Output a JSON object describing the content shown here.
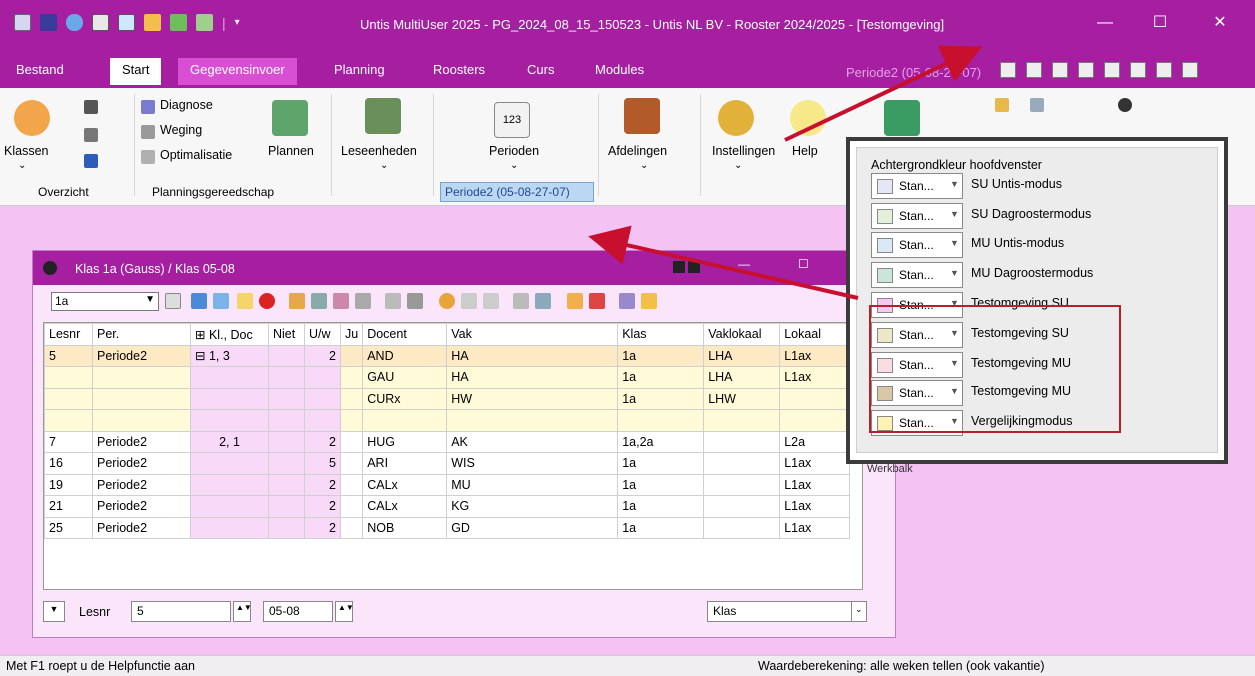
{
  "window": {
    "title": "Untis MultiUser 2025 - PG_2024_08_15_150523  -  Untis NL BV  -  Rooster 2024/2025 - [Testomgeving]",
    "minimize": "—",
    "maximize": "☐",
    "close": "✕",
    "titlebar_color": "#a51fa0"
  },
  "tabs": [
    {
      "label": "Bestand"
    },
    {
      "label": "Start"
    },
    {
      "label": "Gegevensinvoer"
    },
    {
      "label": "Planning"
    },
    {
      "label": "Roosters"
    },
    {
      "label": "Curs"
    },
    {
      "label": "Modules"
    }
  ],
  "tab_period_label": "Periode2 (05-08-27-07)",
  "ribbon": {
    "klassen": "Klassen",
    "overzicht": "Overzicht",
    "diagnose": "Diagnose",
    "weging": "Weging",
    "optimalisatie": "Optimalisatie",
    "plannen": "Plannen",
    "planningsgereedschap": "Planningsgereedschap",
    "leseenheden": "Leseenheden",
    "perioden": "Perioden",
    "period_box": "Periode2 (05-08-27-07)",
    "afdelingen": "Afdelingen",
    "instellingen": "Instellingen",
    "help": "Help",
    "chevron": "⌄"
  },
  "child_window": {
    "title": "Klas 1a (Gauss) / Klas  05-08",
    "klas_combo": "1a",
    "columns": [
      "Lesnr",
      "Per.",
      "Kl., Doc",
      "Niet",
      "U/w",
      "Ju",
      "Docent",
      "Vak",
      "Klas",
      "Vaklokaal",
      "Lokaal"
    ],
    "rows": [
      {
        "lesnr": "5",
        "per": "Periode2",
        "kl": "⊟ 1, 3",
        "uw": "2",
        "docent": "AND",
        "vak": "HA",
        "klas": "1a",
        "vaklokaal": "LHA",
        "lokaal": "L1ax",
        "kind": "sel"
      },
      {
        "lesnr": "",
        "per": "",
        "kl": "",
        "uw": "",
        "docent": "GAU",
        "vak": "HA",
        "klas": "1a",
        "vaklokaal": "LHA",
        "lokaal": "L1ax",
        "kind": "sub"
      },
      {
        "lesnr": "",
        "per": "",
        "kl": "",
        "uw": "",
        "docent": "CURx",
        "vak": "HW",
        "klas": "1a",
        "vaklokaal": "LHW",
        "lokaal": "",
        "kind": "sub"
      },
      {
        "lesnr": "",
        "per": "",
        "kl": "",
        "uw": "",
        "docent": "",
        "vak": "",
        "klas": "",
        "vaklokaal": "",
        "lokaal": "",
        "kind": "sub"
      },
      {
        "lesnr": "7",
        "per": "Periode2",
        "kl": "2, 1",
        "uw": "2",
        "docent": "HUG",
        "vak": "AK",
        "klas": "1a,2a",
        "vaklokaal": "",
        "lokaal": "L2a",
        "kind": ""
      },
      {
        "lesnr": "16",
        "per": "Periode2",
        "kl": "",
        "uw": "5",
        "docent": "ARI",
        "vak": "WIS",
        "klas": "1a",
        "vaklokaal": "",
        "lokaal": "L1ax",
        "kind": ""
      },
      {
        "lesnr": "19",
        "per": "Periode2",
        "kl": "",
        "uw": "2",
        "docent": "CALx",
        "vak": "MU",
        "klas": "1a",
        "vaklokaal": "",
        "lokaal": "L1ax",
        "kind": ""
      },
      {
        "lesnr": "21",
        "per": "Periode2",
        "kl": "",
        "uw": "2",
        "docent": "CALx",
        "vak": "KG",
        "klas": "1a",
        "vaklokaal": "",
        "lokaal": "L1ax",
        "kind": ""
      },
      {
        "lesnr": "25",
        "per": "Periode2",
        "kl": "",
        "uw": "2",
        "docent": "NOB",
        "vak": "GD",
        "klas": "1a",
        "vaklokaal": "",
        "lokaal": "L1ax",
        "kind": ""
      }
    ],
    "bottom": {
      "lesnr_label": "Lesnr",
      "lesnr_value": "5",
      "week_value": "05-08",
      "type_value": "Klas"
    }
  },
  "popup": {
    "heading": "Achtergrondkleur hoofdvenster",
    "stan": "Stan...",
    "items": [
      {
        "label": "SU Untis-modus",
        "color": "#e6e6f7"
      },
      {
        "label": "SU Dagroostermodus",
        "color": "#e3f0d8"
      },
      {
        "label": "MU Untis-modus",
        "color": "#dbe9f7"
      },
      {
        "label": "MU Dagroostermodus",
        "color": "#c9e6d8"
      },
      {
        "label": "Testomgeving SU",
        "color": "#f7c8f2"
      },
      {
        "label": "Testomgeving SU",
        "color": "#ede8c8"
      },
      {
        "label": "Testomgeving MU",
        "color": "#f9dce4"
      },
      {
        "label": "Testomgeving MU",
        "color": "#d8c8a8"
      },
      {
        "label": "Vergelijkingmodus",
        "color": "#fbf3b3"
      }
    ],
    "footer_partial": "Werkbalk"
  },
  "status": {
    "left": "Met F1 roept u de Helpfunctie aan",
    "right": "Waardeberekening: alle weken tellen (ook vakantie)"
  },
  "colors": {
    "accent": "#a51fa0",
    "background": "#f4c3f4",
    "arrow": "#c8102e",
    "highlight": "#b81f2c"
  }
}
